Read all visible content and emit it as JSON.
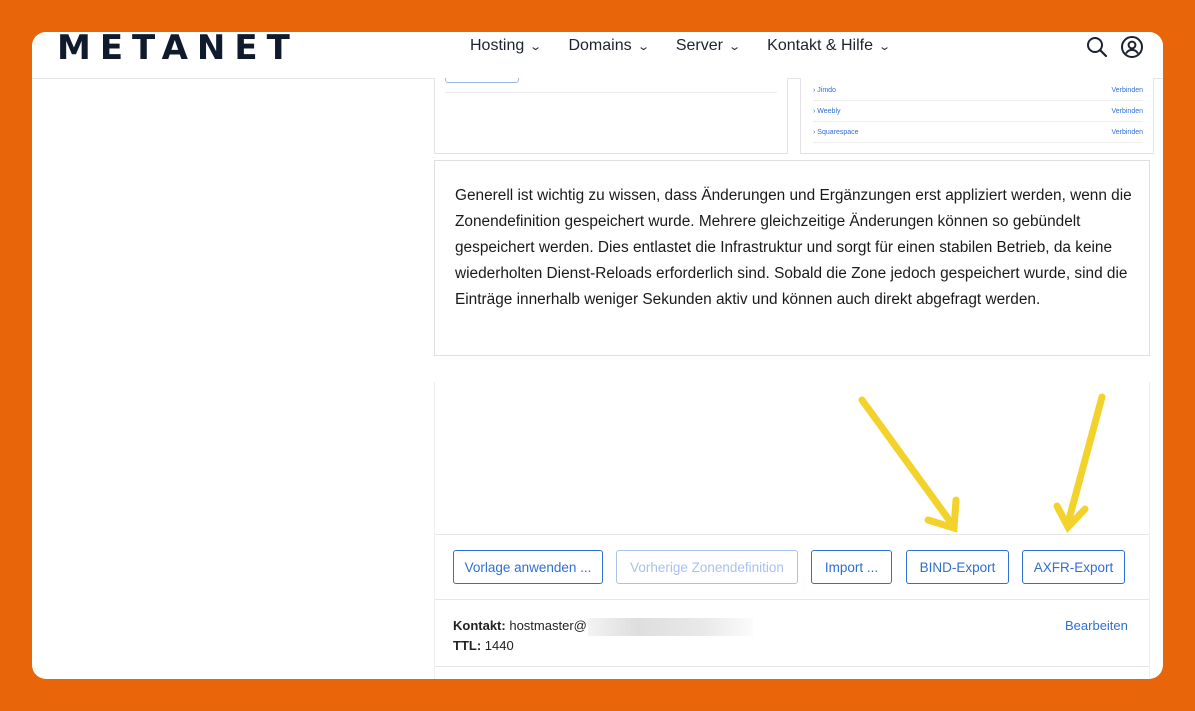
{
  "header": {
    "logo_text": "METANET",
    "nav": [
      {
        "label": "Hosting"
      },
      {
        "label": "Domains"
      },
      {
        "label": "Server"
      },
      {
        "label": "Kontakt & Hilfe"
      }
    ],
    "icons": [
      "search-icon",
      "user-account-icon"
    ]
  },
  "fragment": {
    "rows": [
      {
        "name": "Jimdo",
        "action": "Verbinden"
      },
      {
        "name": "Weebly",
        "action": "Verbinden"
      },
      {
        "name": "Squarespace",
        "action": "Verbinden"
      }
    ]
  },
  "info_text": "Generell ist wichtig zu wissen, dass Änderungen und Ergänzungen erst appliziert werden, wenn die Zonendefinition gespeichert wurde. Mehrere gleichzeitige Änderungen können so gebündelt gespeichert werden. Dies entlastet die Infrastruktur und sorgt für einen stabilen Betrieb, da keine wiederholten Dienst-Reloads erforderlich sind. Sobald die Zone jedoch gespeichert wurde, sind die Einträge innerhalb weniger Sekunden aktiv und können auch direkt abgefragt werden.",
  "toolbar": {
    "apply_template": "Vorlage anwenden ...",
    "previous_zone": "Vorherige Zonendefinition",
    "import": "Import ...",
    "bind_export": "BIND-Export",
    "axfr_export": "AXFR-Export"
  },
  "zone": {
    "contact_label": "Kontakt:",
    "contact_value": "hostmaster@",
    "ttl_label": "TTL:",
    "ttl_value": "1440",
    "edit_link": "Bearbeiten"
  },
  "colors": {
    "background": "#e8650a",
    "link_blue": "#2f6fd6",
    "arrow_yellow": "#f2d22b",
    "logo_accent": "#f5b800"
  }
}
